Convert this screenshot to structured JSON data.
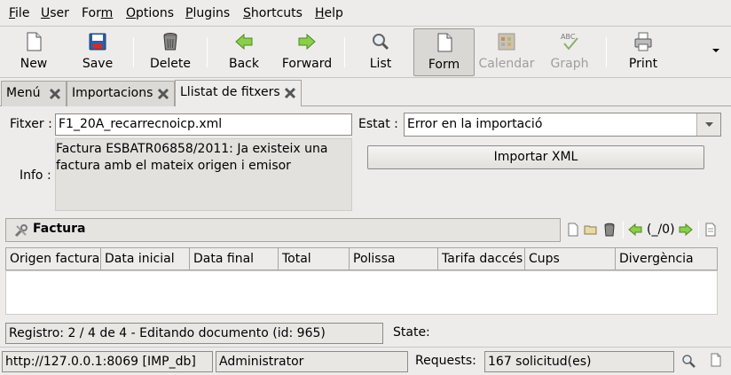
{
  "menubar": {
    "items": [
      {
        "pre": "",
        "ul": "F",
        "post": "ile"
      },
      {
        "pre": "",
        "ul": "U",
        "post": "ser"
      },
      {
        "pre": "For",
        "ul": "m",
        "post": ""
      },
      {
        "pre": "",
        "ul": "O",
        "post": "ptions"
      },
      {
        "pre": "",
        "ul": "P",
        "post": "lugins"
      },
      {
        "pre": "",
        "ul": "S",
        "post": "hortcuts"
      },
      {
        "pre": "",
        "ul": "H",
        "post": "elp"
      }
    ]
  },
  "toolbar": {
    "new_label": "New",
    "save_label": "Save",
    "delete_label": "Delete",
    "back_label": "Back",
    "forward_label": "Forward",
    "list_label": "List",
    "form_label": "Form",
    "calendar_label": "Calendar",
    "graph_label": "Graph",
    "print_label": "Print",
    "graph_icon_text": "ABC"
  },
  "tabs": [
    {
      "label": "Menú",
      "active": false
    },
    {
      "label": "Importacions",
      "active": false
    },
    {
      "label": "Llistat de fitxers",
      "active": true
    }
  ],
  "form": {
    "fitxer_label": "Fitxer :",
    "fitxer_value": "F1_20A_recarrecnoicp.xml",
    "estat_label": "Estat :",
    "estat_value": "Error en la importació",
    "info_label": "Info :",
    "info_value": "Factura ESBATR06858/2011: Ja existeix una factura amb el mateix origen i emisor",
    "import_button": "Importar XML"
  },
  "factura": {
    "title": "Factura",
    "pager": "(_/0)",
    "columns": [
      "Origen factura",
      "Data inicial",
      "Data final",
      "Total",
      "Polissa",
      "Tarifa daccés",
      "Cups",
      "Divergència"
    ]
  },
  "status": {
    "registro": "Registro: 2 / 4 de 4 - Editando documento (id: 965)",
    "state_label": "State:"
  },
  "footer": {
    "server": "http://127.0.0.1:8069 [IMP_db]",
    "user": "Administrator",
    "requests_label": "Requests:",
    "requests_value": "167 solicitud(es)"
  },
  "colors": {
    "arrow_green": "#6cb52e",
    "window_bg": "#edeceb"
  }
}
